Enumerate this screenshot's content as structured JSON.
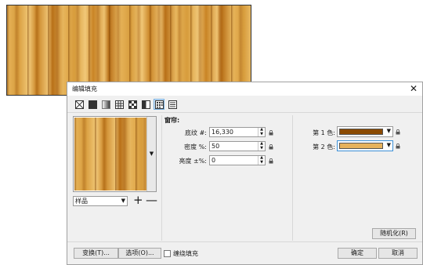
{
  "dialog": {
    "title": "编辑填充",
    "close_glyph": "✕"
  },
  "toolbar": {
    "icons": [
      "no-fill-icon",
      "uniform-fill-icon",
      "fountain-fill-icon",
      "vector-pattern-icon",
      "bitmap-pattern-icon",
      "two-color-pattern-icon",
      "texture-fill-icon",
      "postscript-fill-icon"
    ],
    "active_index": 6
  },
  "left": {
    "sample_select": "样品",
    "add_glyph": "+",
    "remove_glyph": "—"
  },
  "texture": {
    "section_label": "窗帘:",
    "fields": [
      {
        "label": "底纹 #:",
        "value": "16,330"
      },
      {
        "label": "密度 %:",
        "value": "50"
      },
      {
        "label": "亮度 ±%:",
        "value": "0"
      }
    ]
  },
  "colors": {
    "color1_label": "第 1 色:",
    "color1_hex": "#8b4a00",
    "color2_label": "第 2 色:",
    "color2_hex": "#e6b25c"
  },
  "buttons": {
    "randomize": "随机化(R)",
    "transform": "变换(T)...",
    "options": "选项(O)...",
    "seamless": "缠绕填充",
    "ok": "确定",
    "cancel": "取消"
  }
}
